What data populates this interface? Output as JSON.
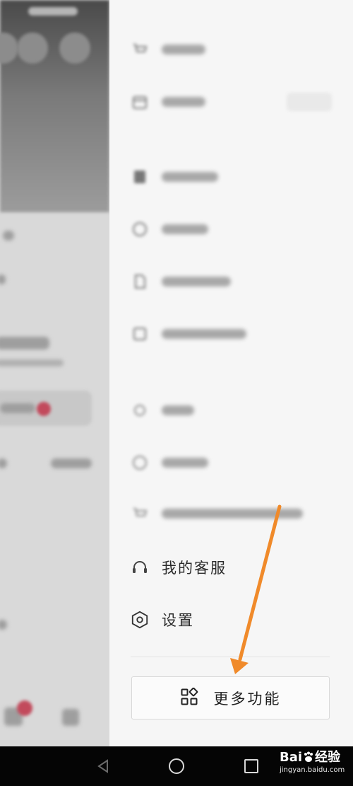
{
  "drawer": {
    "visible_items": [
      {
        "key": "customer_service",
        "label": "我的客服",
        "icon": "headset-icon"
      },
      {
        "key": "settings",
        "label": "设置",
        "icon": "hexagon-settings-icon"
      }
    ],
    "more_button": {
      "label": "更多功能",
      "icon": "grid-apps-icon"
    }
  },
  "navbar": {
    "buttons": [
      "back-triangle-icon",
      "home-circle-icon",
      "recents-square-icon"
    ]
  },
  "watermark": {
    "brand": "Bai",
    "brand_suffix": "经验",
    "url": "jingyan.baidu.com"
  },
  "colors": {
    "arrow": "#f08a2a",
    "drawer_bg": "#f6f6f6",
    "navbar_bg": "#050505"
  }
}
